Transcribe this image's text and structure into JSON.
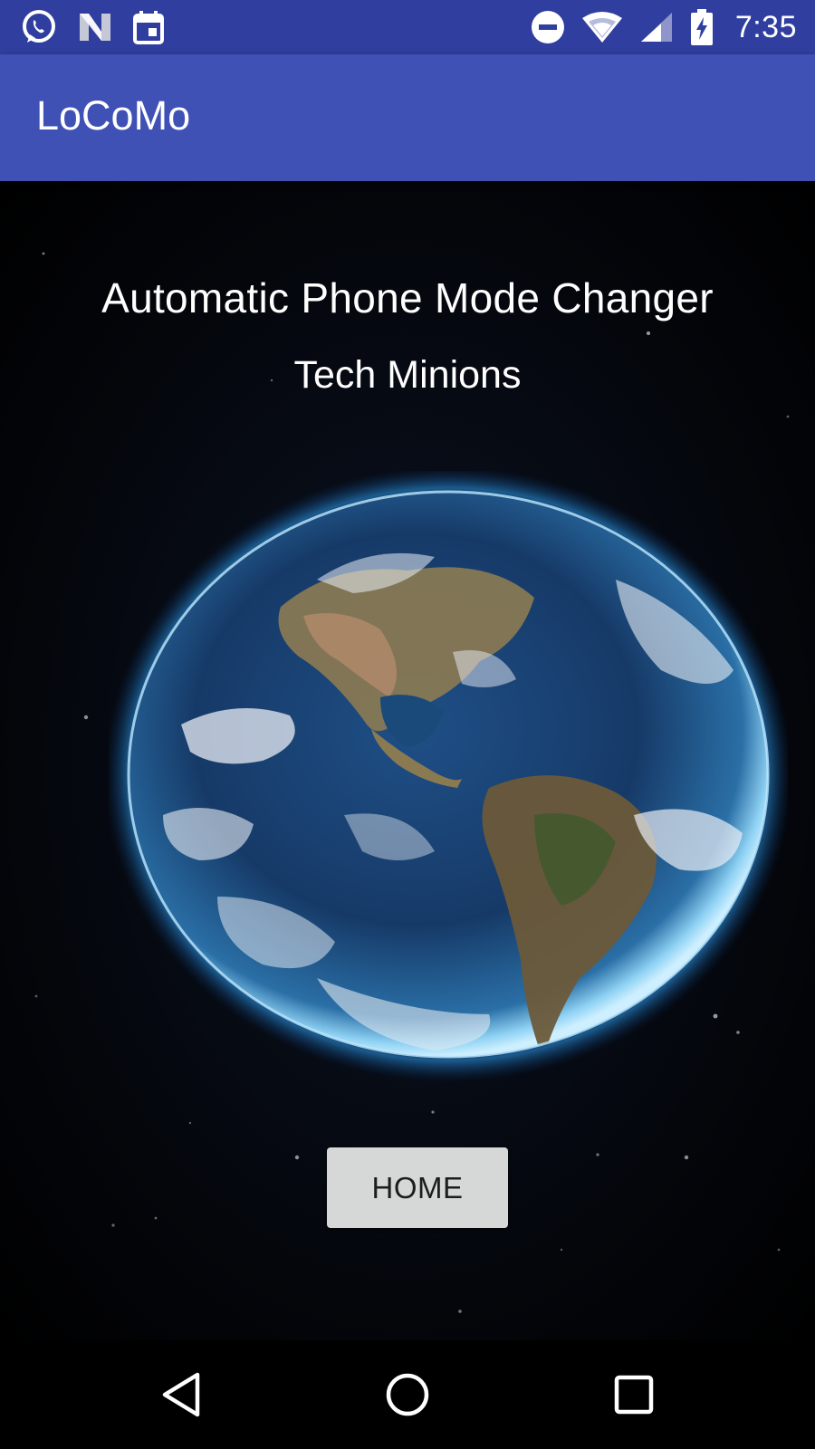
{
  "status_bar": {
    "time": "7:35",
    "left_icons": [
      "whatsapp-icon",
      "n-notification-icon",
      "calendar-icon"
    ],
    "right_icons": [
      "do-not-disturb-icon",
      "wifi-icon",
      "cell-signal-icon",
      "battery-charging-icon"
    ]
  },
  "app_bar": {
    "title": "LoCoMo"
  },
  "main": {
    "headline": "Automatic Phone Mode Changer",
    "subline": "Tech Minions",
    "background_image": "earth-globe-space-image",
    "home_button_label": "HOME"
  },
  "nav_bar": {
    "buttons": [
      "back-icon",
      "home-icon",
      "recents-icon"
    ]
  },
  "colors": {
    "status_bar": "#303f9f",
    "app_bar": "#3f51b5",
    "button_bg": "#d6d7d7",
    "text_light": "#ffffff"
  }
}
